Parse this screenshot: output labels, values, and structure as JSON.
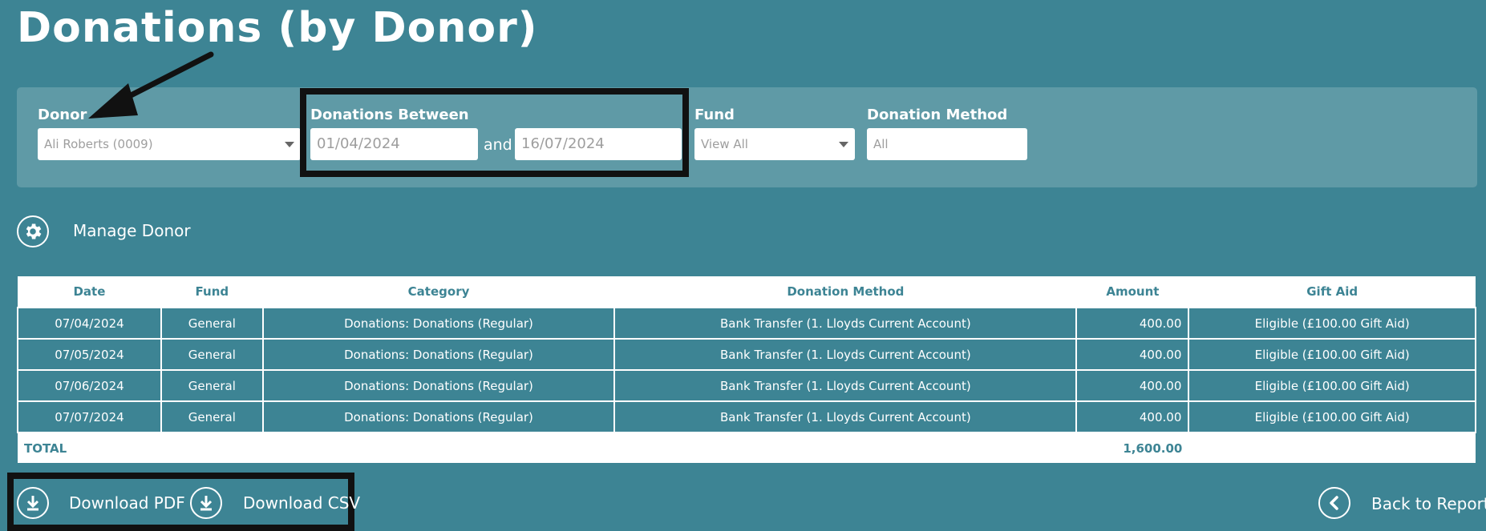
{
  "page": {
    "title": "Donations (by Donor)"
  },
  "filters": {
    "donor": {
      "label": "Donor",
      "value": "Ali Roberts (0009)"
    },
    "date_range": {
      "label": "Donations Between",
      "from": "01/04/2024",
      "joiner": "and",
      "to": "16/07/2024"
    },
    "fund": {
      "label": "Fund",
      "value": "View All"
    },
    "donation_method": {
      "label": "Donation Method",
      "value": "All"
    }
  },
  "actions": {
    "manage_donor": "Manage Donor",
    "download_pdf": "Download PDF",
    "download_csv": "Download CSV",
    "back_to_reports": "Back to Reports"
  },
  "table": {
    "headers": {
      "date": "Date",
      "fund": "Fund",
      "category": "Category",
      "method": "Donation Method",
      "amount": "Amount",
      "gift_aid": "Gift Aid"
    },
    "rows": [
      {
        "date": "07/04/2024",
        "fund": "General",
        "category": "Donations: Donations (Regular)",
        "method": "Bank Transfer (1. Lloyds Current Account)",
        "amount": "400.00",
        "gift_aid": "Eligible (£100.00 Gift Aid)"
      },
      {
        "date": "07/05/2024",
        "fund": "General",
        "category": "Donations: Donations (Regular)",
        "method": "Bank Transfer (1. Lloyds Current Account)",
        "amount": "400.00",
        "gift_aid": "Eligible (£100.00 Gift Aid)"
      },
      {
        "date": "07/06/2024",
        "fund": "General",
        "category": "Donations: Donations (Regular)",
        "method": "Bank Transfer (1. Lloyds Current Account)",
        "amount": "400.00",
        "gift_aid": "Eligible (£100.00 Gift Aid)"
      },
      {
        "date": "07/07/2024",
        "fund": "General",
        "category": "Donations: Donations (Regular)",
        "method": "Bank Transfer (1. Lloyds Current Account)",
        "amount": "400.00",
        "gift_aid": "Eligible (£100.00 Gift Aid)"
      }
    ],
    "total": {
      "label": "TOTAL",
      "amount": "1,600.00"
    }
  },
  "icons": {
    "manage": "gear-icon",
    "download": "download-icon",
    "back": "chevron-left-icon",
    "dropdown": "caret-down-icon",
    "annotation": "arrow-annotation"
  },
  "colors": {
    "background": "#3d8494",
    "panel": "#5f9aa6",
    "header_text": "#3d8494",
    "annotation": "#111111"
  }
}
